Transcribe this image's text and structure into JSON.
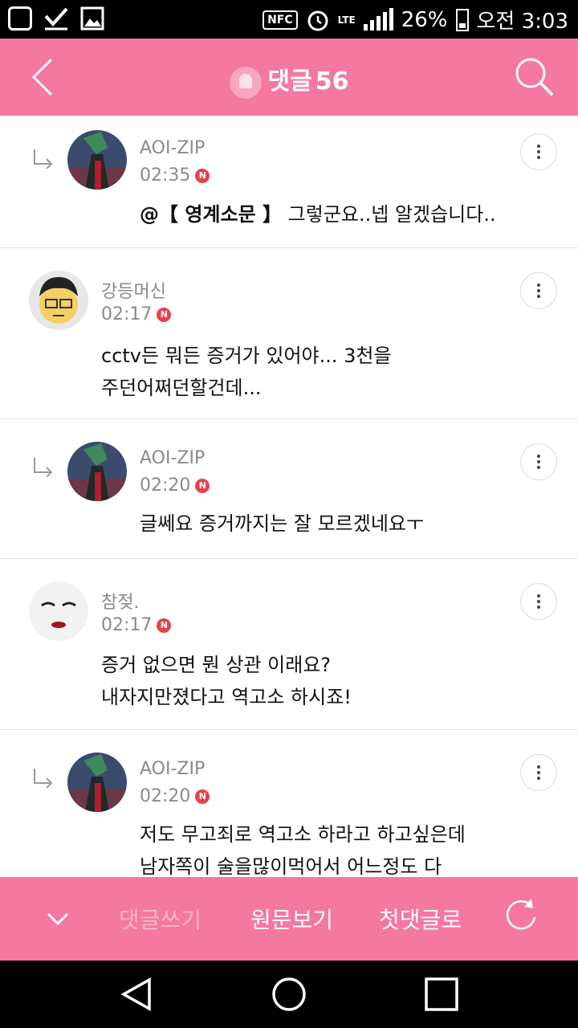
{
  "status_bar": {
    "nfc": "NFC",
    "lte": "LTE",
    "battery": "26%",
    "time": "오전 3:03"
  },
  "header": {
    "title": "댓글",
    "count": "56"
  },
  "comments": [
    {
      "author": "AOI-ZIP",
      "time": "02:35",
      "badge": "N",
      "mention": "@【 영계소문 】",
      "text": " 그렇군요..넵 알겠습니다..",
      "is_reply": true
    },
    {
      "author": "강등머신",
      "time": "02:17",
      "badge": "N",
      "text": "cctv든 뭐든 증거가 있어야... 3천을\n주던어쩌던할건데...",
      "is_reply": false
    },
    {
      "author": "AOI-ZIP",
      "time": "02:20",
      "badge": "N",
      "text": "글쎄요 증거까지는 잘 모르겠네요ㅜ",
      "is_reply": true
    },
    {
      "author": "참젖.",
      "time": "02:17",
      "badge": "N",
      "text": "증거 없으면 뭔 상관 이래요?\n내자지만졌다고 역고소 하시죠!",
      "is_reply": false
    },
    {
      "author": "AOI-ZIP",
      "time": "02:20",
      "badge": "N",
      "text": "저도 무고죄로 역고소 하라고 하고싶은데\n남자쪽이 술을많이먹어서 어느정도 다",
      "is_reply": true
    }
  ],
  "bottom_bar": {
    "write": "댓글쓰기",
    "original": "원문보기",
    "first": "첫댓글로"
  },
  "colors": {
    "accent": "#f4789f",
    "badge": "#e8414a"
  }
}
